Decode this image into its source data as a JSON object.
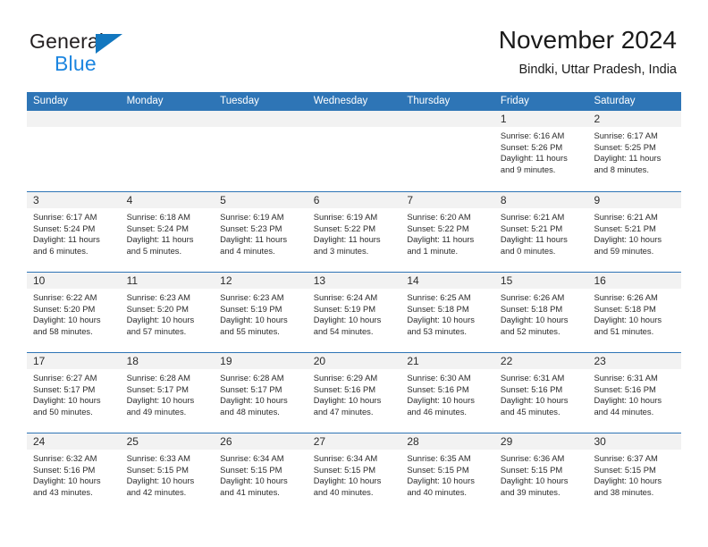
{
  "brand": {
    "name_part1": "General",
    "name_part2": "Blue",
    "triangle_color": "#1277bf",
    "blue_color": "#1d86e0"
  },
  "header": {
    "title": "November 2024",
    "subtitle": "Bindki, Uttar Pradesh, India"
  },
  "theme": {
    "header_blue": "#2e75b6",
    "daynum_band": "#f2f2f2",
    "text": "#2b2b2b"
  },
  "weekday_headers": [
    "Sunday",
    "Monday",
    "Tuesday",
    "Wednesday",
    "Thursday",
    "Friday",
    "Saturday"
  ],
  "weeks": [
    [
      {
        "day": "",
        "empty": true
      },
      {
        "day": "",
        "empty": true
      },
      {
        "day": "",
        "empty": true
      },
      {
        "day": "",
        "empty": true
      },
      {
        "day": "",
        "empty": true
      },
      {
        "day": "1",
        "sunrise": "Sunrise: 6:16 AM",
        "sunset": "Sunset: 5:26 PM",
        "daylight": "Daylight: 11 hours and 9 minutes."
      },
      {
        "day": "2",
        "sunrise": "Sunrise: 6:17 AM",
        "sunset": "Sunset: 5:25 PM",
        "daylight": "Daylight: 11 hours and 8 minutes."
      }
    ],
    [
      {
        "day": "3",
        "sunrise": "Sunrise: 6:17 AM",
        "sunset": "Sunset: 5:24 PM",
        "daylight": "Daylight: 11 hours and 6 minutes."
      },
      {
        "day": "4",
        "sunrise": "Sunrise: 6:18 AM",
        "sunset": "Sunset: 5:24 PM",
        "daylight": "Daylight: 11 hours and 5 minutes."
      },
      {
        "day": "5",
        "sunrise": "Sunrise: 6:19 AM",
        "sunset": "Sunset: 5:23 PM",
        "daylight": "Daylight: 11 hours and 4 minutes."
      },
      {
        "day": "6",
        "sunrise": "Sunrise: 6:19 AM",
        "sunset": "Sunset: 5:22 PM",
        "daylight": "Daylight: 11 hours and 3 minutes."
      },
      {
        "day": "7",
        "sunrise": "Sunrise: 6:20 AM",
        "sunset": "Sunset: 5:22 PM",
        "daylight": "Daylight: 11 hours and 1 minute."
      },
      {
        "day": "8",
        "sunrise": "Sunrise: 6:21 AM",
        "sunset": "Sunset: 5:21 PM",
        "daylight": "Daylight: 11 hours and 0 minutes."
      },
      {
        "day": "9",
        "sunrise": "Sunrise: 6:21 AM",
        "sunset": "Sunset: 5:21 PM",
        "daylight": "Daylight: 10 hours and 59 minutes."
      }
    ],
    [
      {
        "day": "10",
        "sunrise": "Sunrise: 6:22 AM",
        "sunset": "Sunset: 5:20 PM",
        "daylight": "Daylight: 10 hours and 58 minutes."
      },
      {
        "day": "11",
        "sunrise": "Sunrise: 6:23 AM",
        "sunset": "Sunset: 5:20 PM",
        "daylight": "Daylight: 10 hours and 57 minutes."
      },
      {
        "day": "12",
        "sunrise": "Sunrise: 6:23 AM",
        "sunset": "Sunset: 5:19 PM",
        "daylight": "Daylight: 10 hours and 55 minutes."
      },
      {
        "day": "13",
        "sunrise": "Sunrise: 6:24 AM",
        "sunset": "Sunset: 5:19 PM",
        "daylight": "Daylight: 10 hours and 54 minutes."
      },
      {
        "day": "14",
        "sunrise": "Sunrise: 6:25 AM",
        "sunset": "Sunset: 5:18 PM",
        "daylight": "Daylight: 10 hours and 53 minutes."
      },
      {
        "day": "15",
        "sunrise": "Sunrise: 6:26 AM",
        "sunset": "Sunset: 5:18 PM",
        "daylight": "Daylight: 10 hours and 52 minutes."
      },
      {
        "day": "16",
        "sunrise": "Sunrise: 6:26 AM",
        "sunset": "Sunset: 5:18 PM",
        "daylight": "Daylight: 10 hours and 51 minutes."
      }
    ],
    [
      {
        "day": "17",
        "sunrise": "Sunrise: 6:27 AM",
        "sunset": "Sunset: 5:17 PM",
        "daylight": "Daylight: 10 hours and 50 minutes."
      },
      {
        "day": "18",
        "sunrise": "Sunrise: 6:28 AM",
        "sunset": "Sunset: 5:17 PM",
        "daylight": "Daylight: 10 hours and 49 minutes."
      },
      {
        "day": "19",
        "sunrise": "Sunrise: 6:28 AM",
        "sunset": "Sunset: 5:17 PM",
        "daylight": "Daylight: 10 hours and 48 minutes."
      },
      {
        "day": "20",
        "sunrise": "Sunrise: 6:29 AM",
        "sunset": "Sunset: 5:16 PM",
        "daylight": "Daylight: 10 hours and 47 minutes."
      },
      {
        "day": "21",
        "sunrise": "Sunrise: 6:30 AM",
        "sunset": "Sunset: 5:16 PM",
        "daylight": "Daylight: 10 hours and 46 minutes."
      },
      {
        "day": "22",
        "sunrise": "Sunrise: 6:31 AM",
        "sunset": "Sunset: 5:16 PM",
        "daylight": "Daylight: 10 hours and 45 minutes."
      },
      {
        "day": "23",
        "sunrise": "Sunrise: 6:31 AM",
        "sunset": "Sunset: 5:16 PM",
        "daylight": "Daylight: 10 hours and 44 minutes."
      }
    ],
    [
      {
        "day": "24",
        "sunrise": "Sunrise: 6:32 AM",
        "sunset": "Sunset: 5:16 PM",
        "daylight": "Daylight: 10 hours and 43 minutes."
      },
      {
        "day": "25",
        "sunrise": "Sunrise: 6:33 AM",
        "sunset": "Sunset: 5:15 PM",
        "daylight": "Daylight: 10 hours and 42 minutes."
      },
      {
        "day": "26",
        "sunrise": "Sunrise: 6:34 AM",
        "sunset": "Sunset: 5:15 PM",
        "daylight": "Daylight: 10 hours and 41 minutes."
      },
      {
        "day": "27",
        "sunrise": "Sunrise: 6:34 AM",
        "sunset": "Sunset: 5:15 PM",
        "daylight": "Daylight: 10 hours and 40 minutes."
      },
      {
        "day": "28",
        "sunrise": "Sunrise: 6:35 AM",
        "sunset": "Sunset: 5:15 PM",
        "daylight": "Daylight: 10 hours and 40 minutes."
      },
      {
        "day": "29",
        "sunrise": "Sunrise: 6:36 AM",
        "sunset": "Sunset: 5:15 PM",
        "daylight": "Daylight: 10 hours and 39 minutes."
      },
      {
        "day": "30",
        "sunrise": "Sunrise: 6:37 AM",
        "sunset": "Sunset: 5:15 PM",
        "daylight": "Daylight: 10 hours and 38 minutes."
      }
    ]
  ]
}
